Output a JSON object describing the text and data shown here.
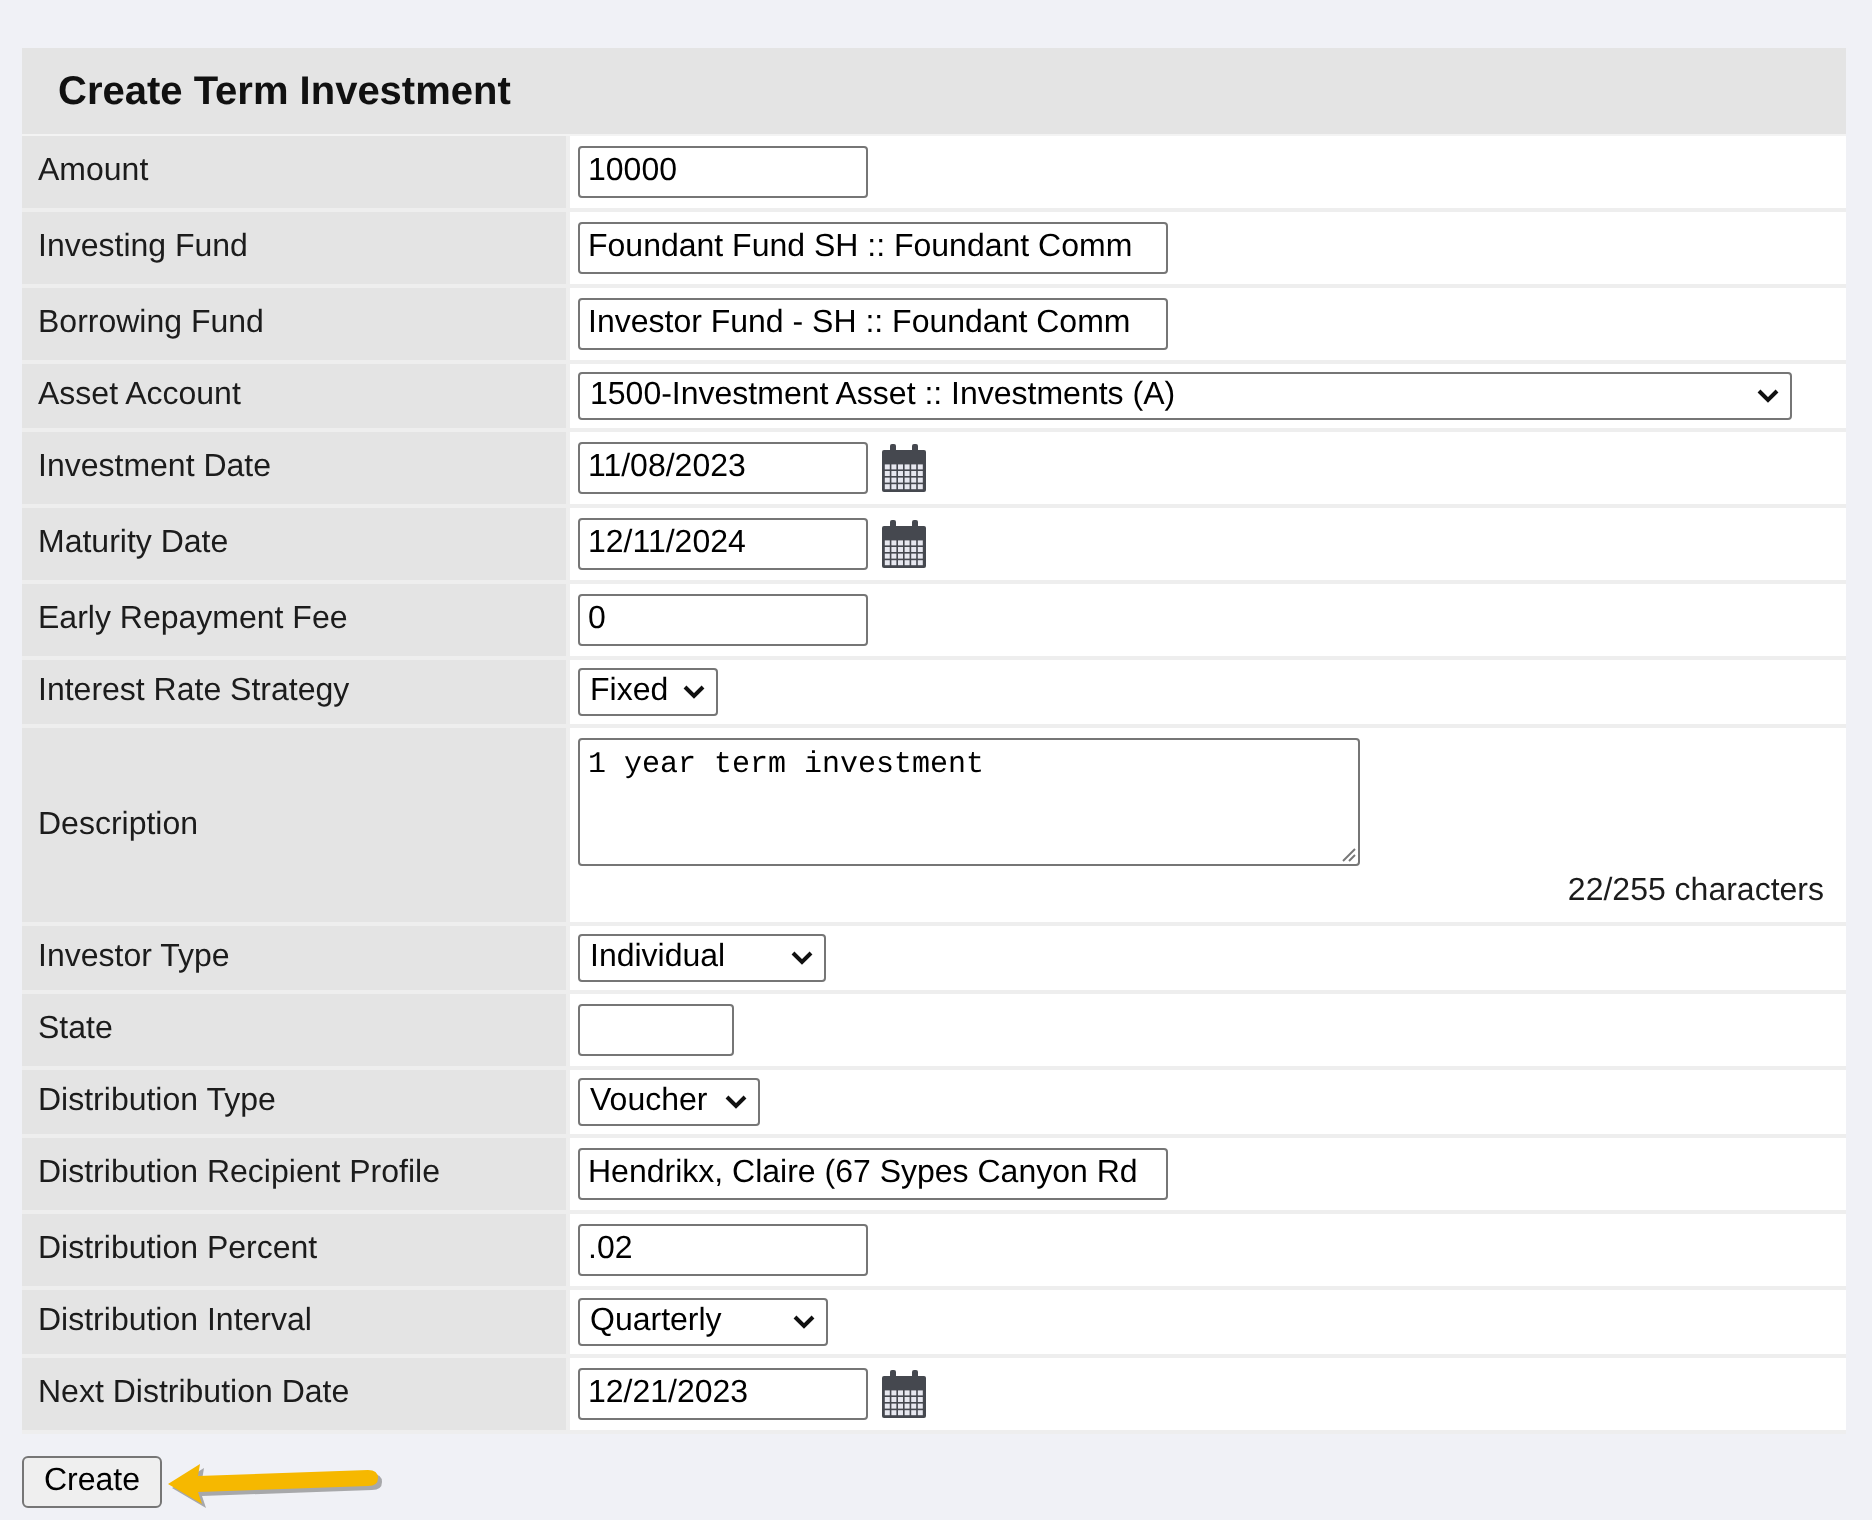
{
  "form": {
    "title": "Create Term Investment",
    "fields": [
      {
        "label": "Amount",
        "kind": "text",
        "value": "10000"
      },
      {
        "label": "Investing Fund",
        "kind": "text",
        "value": "Foundant Fund SH :: Foundant Comm"
      },
      {
        "label": "Borrowing Fund",
        "kind": "text",
        "value": "Investor Fund - SH :: Foundant Comm"
      },
      {
        "label": "Asset Account",
        "kind": "select",
        "value": "1500-Investment Asset :: Investments (A)"
      },
      {
        "label": "Investment Date",
        "kind": "date",
        "value": "11/08/2023"
      },
      {
        "label": "Maturity Date",
        "kind": "date",
        "value": "12/11/2024"
      },
      {
        "label": "Early Repayment Fee",
        "kind": "text",
        "value": "0"
      },
      {
        "label": "Interest Rate Strategy",
        "kind": "select",
        "value": "Fixed"
      },
      {
        "label": "Description",
        "kind": "textarea",
        "value": "1 year term investment",
        "counter": "22/255 characters"
      },
      {
        "label": "Investor Type",
        "kind": "select",
        "value": "Individual"
      },
      {
        "label": "State",
        "kind": "text"
      },
      {
        "label": "Distribution Type",
        "kind": "select",
        "value": "Voucher"
      },
      {
        "label": "Distribution Recipient Profile",
        "kind": "text",
        "value": "Hendrikx, Claire (67 Sypes Canyon Rd"
      },
      {
        "label": "Distribution Percent",
        "kind": "text",
        "value": ".02"
      },
      {
        "label": "Distribution Interval",
        "kind": "select",
        "value": "Quarterly"
      },
      {
        "label": "Next Distribution Date",
        "kind": "date",
        "value": "12/21/2023"
      }
    ]
  },
  "create_button": {
    "label": "Create"
  }
}
